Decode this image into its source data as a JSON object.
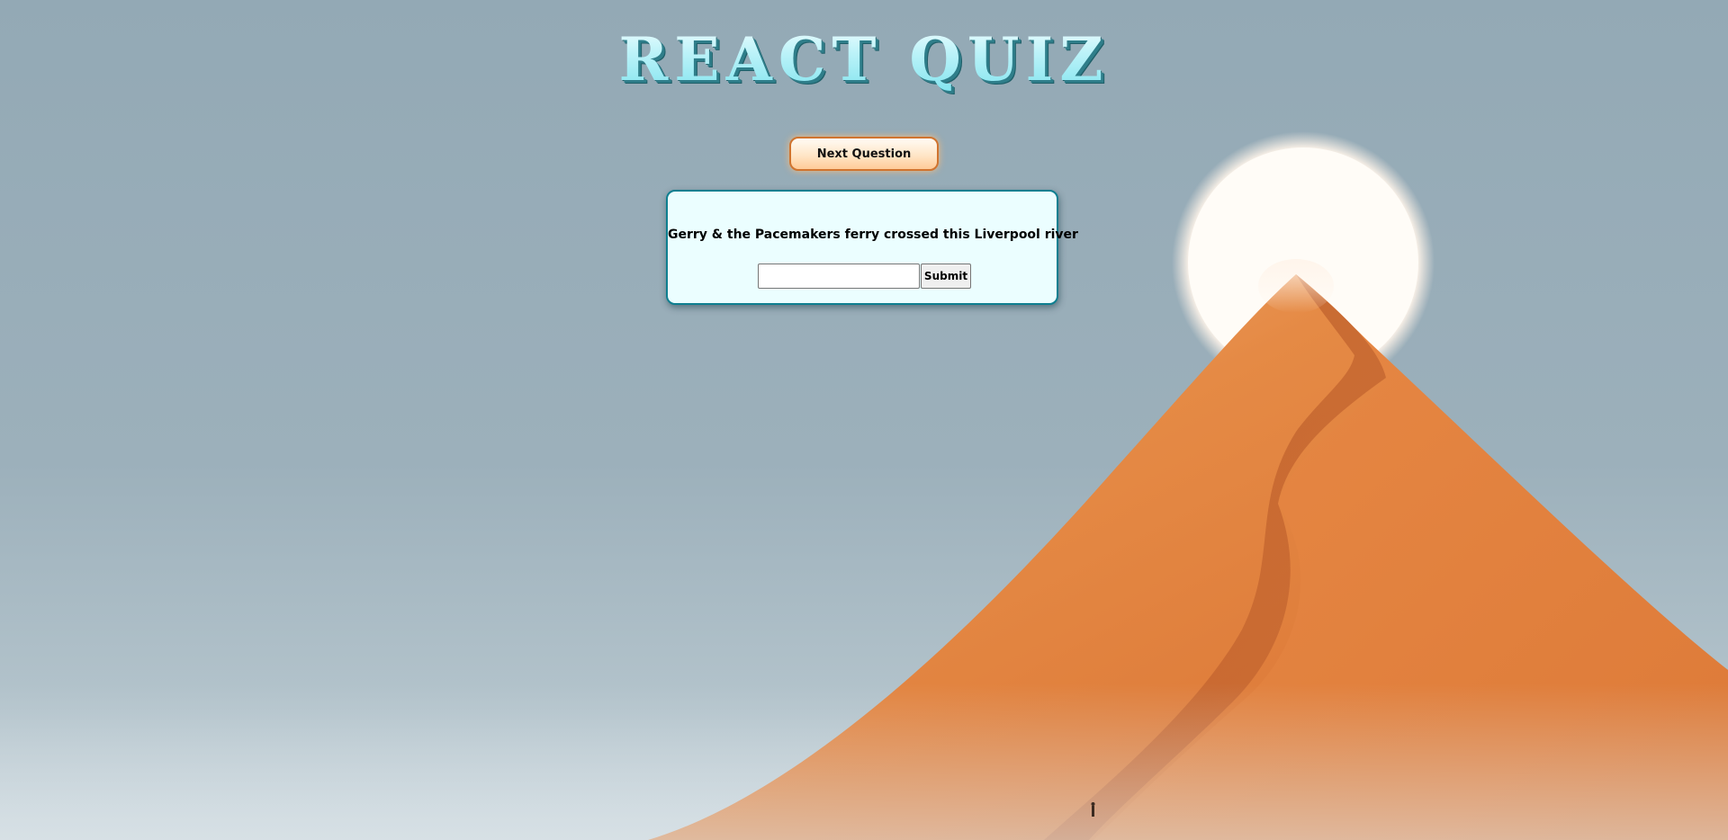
{
  "app": {
    "title": "REACT QUIZ"
  },
  "controls": {
    "next_label": "Next Question"
  },
  "quiz": {
    "question": "Gerry & the Pacemakers ferry crossed this Liverpool river",
    "answer_value": "",
    "answer_placeholder": "",
    "submit_label": "Submit"
  },
  "colors": {
    "sky": "#9aafba",
    "dune_light": "#e8843f",
    "dune_shadow": "#bd5d2a",
    "sun": "#fffdf8",
    "card_border": "#0e7f90",
    "card_background": "#ebfeff",
    "next_button_border": "#d0742f"
  }
}
